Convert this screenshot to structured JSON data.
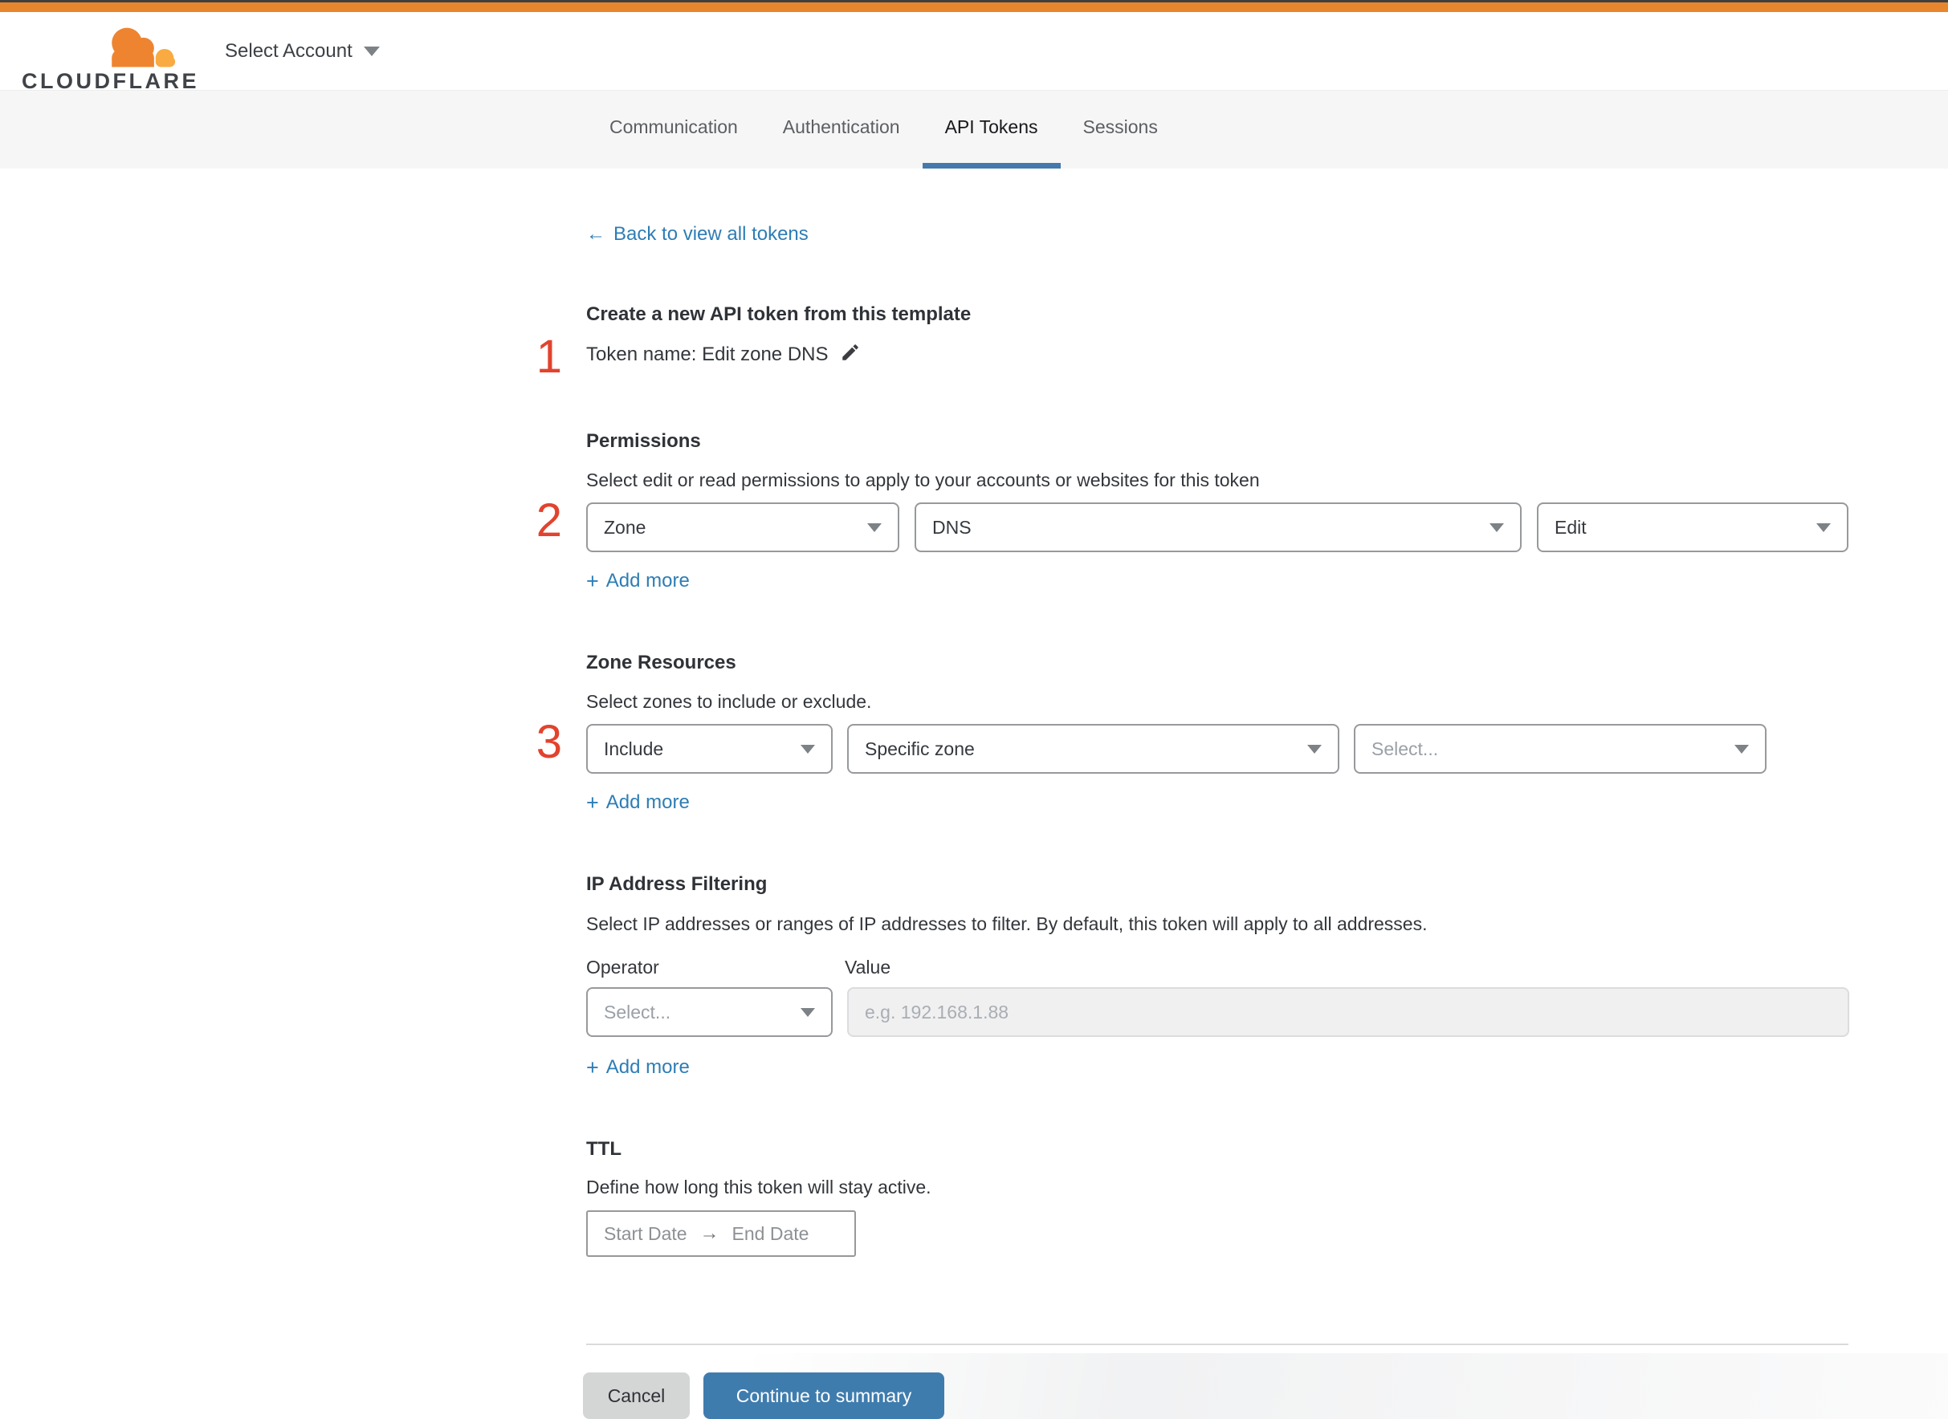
{
  "header": {
    "brand": "CLOUDFLARE",
    "account_selector": "Select Account"
  },
  "tabs": [
    {
      "label": "Communication",
      "active": false
    },
    {
      "label": "Authentication",
      "active": false
    },
    {
      "label": "API Tokens",
      "active": true
    },
    {
      "label": "Sessions",
      "active": false
    }
  ],
  "back_link": {
    "label": "Back to view all tokens"
  },
  "steps": [
    "1",
    "2",
    "3"
  ],
  "create_section": {
    "title": "Create a new API token from this template",
    "token_name": "Token name: Edit zone DNS"
  },
  "permissions": {
    "title": "Permissions",
    "description": "Select edit or read permissions to apply to your accounts or websites for this token",
    "selects": [
      {
        "value": "Zone"
      },
      {
        "value": "DNS"
      },
      {
        "value": "Edit"
      }
    ],
    "add_more": "Add more"
  },
  "zone_resources": {
    "title": "Zone Resources",
    "description": "Select zones to include or exclude.",
    "selects": [
      {
        "value": "Include"
      },
      {
        "value": "Specific zone"
      }
    ],
    "zone_placeholder": "Select...",
    "add_more": "Add more"
  },
  "ip_filtering": {
    "title": "IP Address Filtering",
    "description": "Select IP addresses or ranges of IP addresses to filter. By default, this token will apply to all addresses.",
    "operator_label": "Operator",
    "value_label": "Value",
    "operator_placeholder": "Select...",
    "value_placeholder": "e.g. 192.168.1.88",
    "add_more": "Add more"
  },
  "ttl": {
    "title": "TTL",
    "description": "Define how long this token will stay active.",
    "start_label": "Start Date",
    "end_label": "End Date"
  },
  "footer": {
    "cancel_label": "Cancel",
    "continue_label": "Continue to summary"
  },
  "icons": {
    "plus": "+",
    "back_arrow": "←",
    "range_arrow": "→"
  },
  "colors": {
    "brand_orange": "#e8862e",
    "logo_orange": "#ee8430",
    "logo_light_orange": "#f9ab41",
    "accent_blue": "#2e7db5",
    "tab_underline": "#4579ab",
    "step_red": "#e2432e",
    "continue_button_blue": "#3f7cae"
  }
}
